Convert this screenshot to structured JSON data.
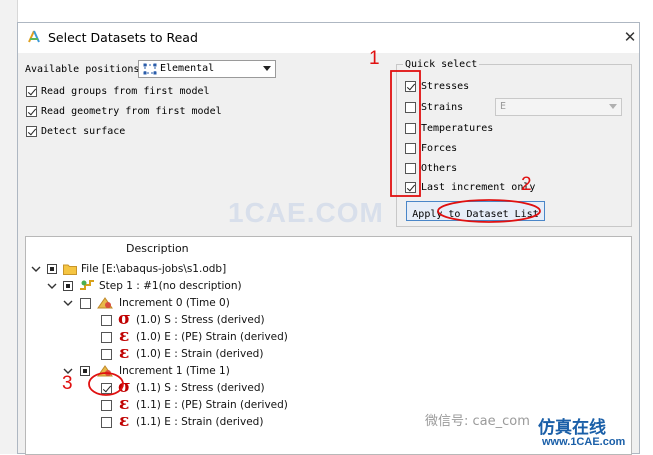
{
  "dialog": {
    "title": "Select Datasets to Read",
    "close_glyph": "✕"
  },
  "positions": {
    "label": "Available positions:",
    "value": "Elemental"
  },
  "options": [
    {
      "label": "Read groups from first model",
      "checked": true
    },
    {
      "label": "Read geometry from first model",
      "checked": true
    },
    {
      "label": "Detect surface",
      "checked": true
    }
  ],
  "quick_select": {
    "title": "Quick select",
    "items": [
      {
        "label": "Stresses",
        "checked": true
      },
      {
        "label": "Strains",
        "checked": false
      },
      {
        "label": "Temperatures",
        "checked": false
      },
      {
        "label": "Forces",
        "checked": false
      },
      {
        "label": "Others",
        "checked": false
      },
      {
        "label": "Last increment only",
        "checked": true
      }
    ],
    "strains_value": "E",
    "apply_label": "Apply to Dataset List"
  },
  "tree": {
    "header": "Description",
    "file": "File [E:\\abaqus-jobs\\s1.odb]",
    "step": "Step 1 : #1(no description)",
    "increments": [
      {
        "label": "Increment 0 (Time 0)",
        "datasets": [
          {
            "symbol": "σ",
            "label": "(1.0) S :  Stress (derived)",
            "checked": false
          },
          {
            "symbol": "ε",
            "label": "(1.0) E :  (PE) Strain (derived)",
            "checked": false
          },
          {
            "symbol": "ε",
            "label": "(1.0) E :  Strain (derived)",
            "checked": false
          }
        ]
      },
      {
        "label": "Increment 1 (Time 1)",
        "datasets": [
          {
            "symbol": "σ",
            "label": "(1.1) S :  Stress (derived)",
            "checked": true
          },
          {
            "symbol": "ε",
            "label": "(1.1) E :  (PE) Strain (derived)",
            "checked": false
          },
          {
            "symbol": "ε",
            "label": "(1.1) E :  Strain (derived)",
            "checked": false
          }
        ]
      }
    ]
  },
  "annotations": {
    "one": "1",
    "two": "2",
    "three": "3"
  },
  "watermarks": {
    "center": "1CAE.COM",
    "wechat": "微信号: cae_com",
    "logo": "仿真在线",
    "url": "www.1CAE.com"
  },
  "colors": {
    "annotation": "#e01010",
    "accent": "#4a86c8",
    "symbol": "#c00000"
  }
}
